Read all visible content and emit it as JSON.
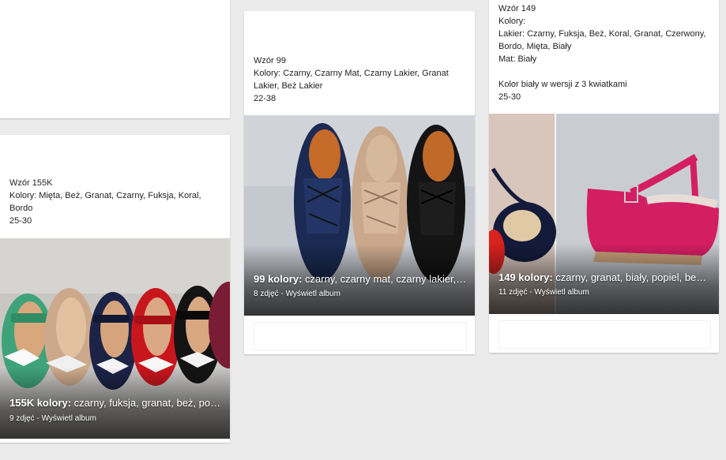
{
  "cards": [
    {
      "id": "155k",
      "desc": {
        "line1": "Wzór 155K",
        "line2": "Kolory: Mięta, Beż, Granat, Czarny, Fuksja, Koral,",
        "line3": "Bordo",
        "line4": "25-30"
      },
      "album": {
        "title_bold": "155K kolory:",
        "title_rest": " czarny, fuksja, granat, beż, popi...",
        "count": "9 zdjęć",
        "separator": " - ",
        "link": "Wyświetl album"
      }
    },
    {
      "id": "99",
      "desc": {
        "line1": "Wzór 99",
        "line2": "Kolory: Czarny, Czarny Mat, Czarny Lakier, Granat",
        "line3": "Lakier, Beż Lakier",
        "line4": "22-38"
      },
      "album": {
        "title_bold": "99 kolory:",
        "title_rest": " czarny, czarny mat, czarny lakier, ...",
        "count": "8 zdjęć",
        "separator": " - ",
        "link": "Wyświetl album"
      }
    },
    {
      "id": "149",
      "desc": {
        "line1": "Wzór 149",
        "line2": "Kolory:",
        "line3": "Lakier: Czarny, Fuksja, Beż, Koral, Granat, Czerwony,",
        "line4": "Bordo, Mięta, Biały",
        "line5": "Mat: Biały",
        "line6": "Kolor biały w wersji z 3 kwiatkami",
        "line7": "25-30"
      },
      "album": {
        "title_bold": "149 kolory:",
        "title_rest": " czarny, granat, biały, popiel, beż, ...",
        "count": "11 zdjęć",
        "separator": " - ",
        "link": "Wyświetl album"
      }
    }
  ],
  "colors": {
    "background": "#ebebeb",
    "card": "#ffffff",
    "text": "#222222",
    "overlay_text": "#ffffff"
  }
}
